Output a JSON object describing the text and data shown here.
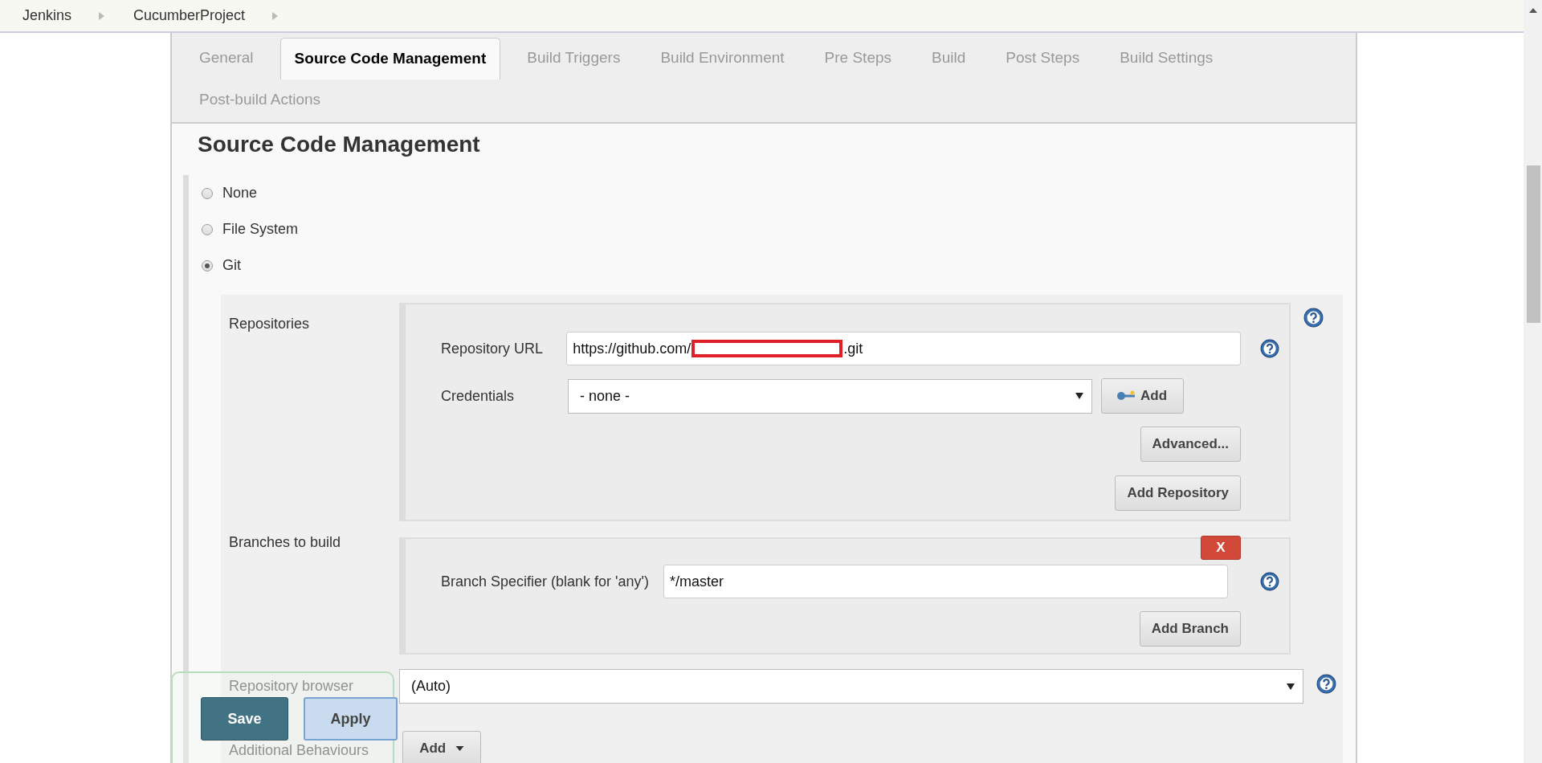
{
  "breadcrumbs": [
    {
      "label": "Jenkins"
    },
    {
      "label": "CucumberProject"
    }
  ],
  "tabs": [
    {
      "label": "General",
      "selected": false
    },
    {
      "label": "Source Code Management",
      "selected": true
    },
    {
      "label": "Build Triggers",
      "selected": false
    },
    {
      "label": "Build Environment",
      "selected": false
    },
    {
      "label": "Pre Steps",
      "selected": false
    },
    {
      "label": "Build",
      "selected": false
    },
    {
      "label": "Post Steps",
      "selected": false
    },
    {
      "label": "Build Settings",
      "selected": false
    },
    {
      "label": "Post-build Actions",
      "selected": false
    }
  ],
  "section_title": "Source Code Management",
  "scm_options": [
    {
      "label": "None",
      "selected": false
    },
    {
      "label": "File System",
      "selected": false
    },
    {
      "label": "Git",
      "selected": true
    }
  ],
  "repositories": {
    "label": "Repositories",
    "url_label": "Repository URL",
    "url_value_start": "https://github.com/",
    "url_value_end": ".git",
    "credentials_label": "Credentials",
    "credentials_value": "- none -",
    "add_button": "Add",
    "advanced_button": "Advanced...",
    "add_repository_button": "Add Repository"
  },
  "branches": {
    "label": "Branches to build",
    "delete_button": "X",
    "specifier_label": "Branch Specifier (blank for 'any')",
    "specifier_value": "*/master",
    "add_branch_button": "Add Branch"
  },
  "repository_browser": {
    "label": "Repository browser",
    "value": "(Auto)"
  },
  "additional_behaviours": {
    "label": "Additional Behaviours",
    "add_button": "Add"
  },
  "actions": [
    "Save",
    "Apply"
  ]
}
